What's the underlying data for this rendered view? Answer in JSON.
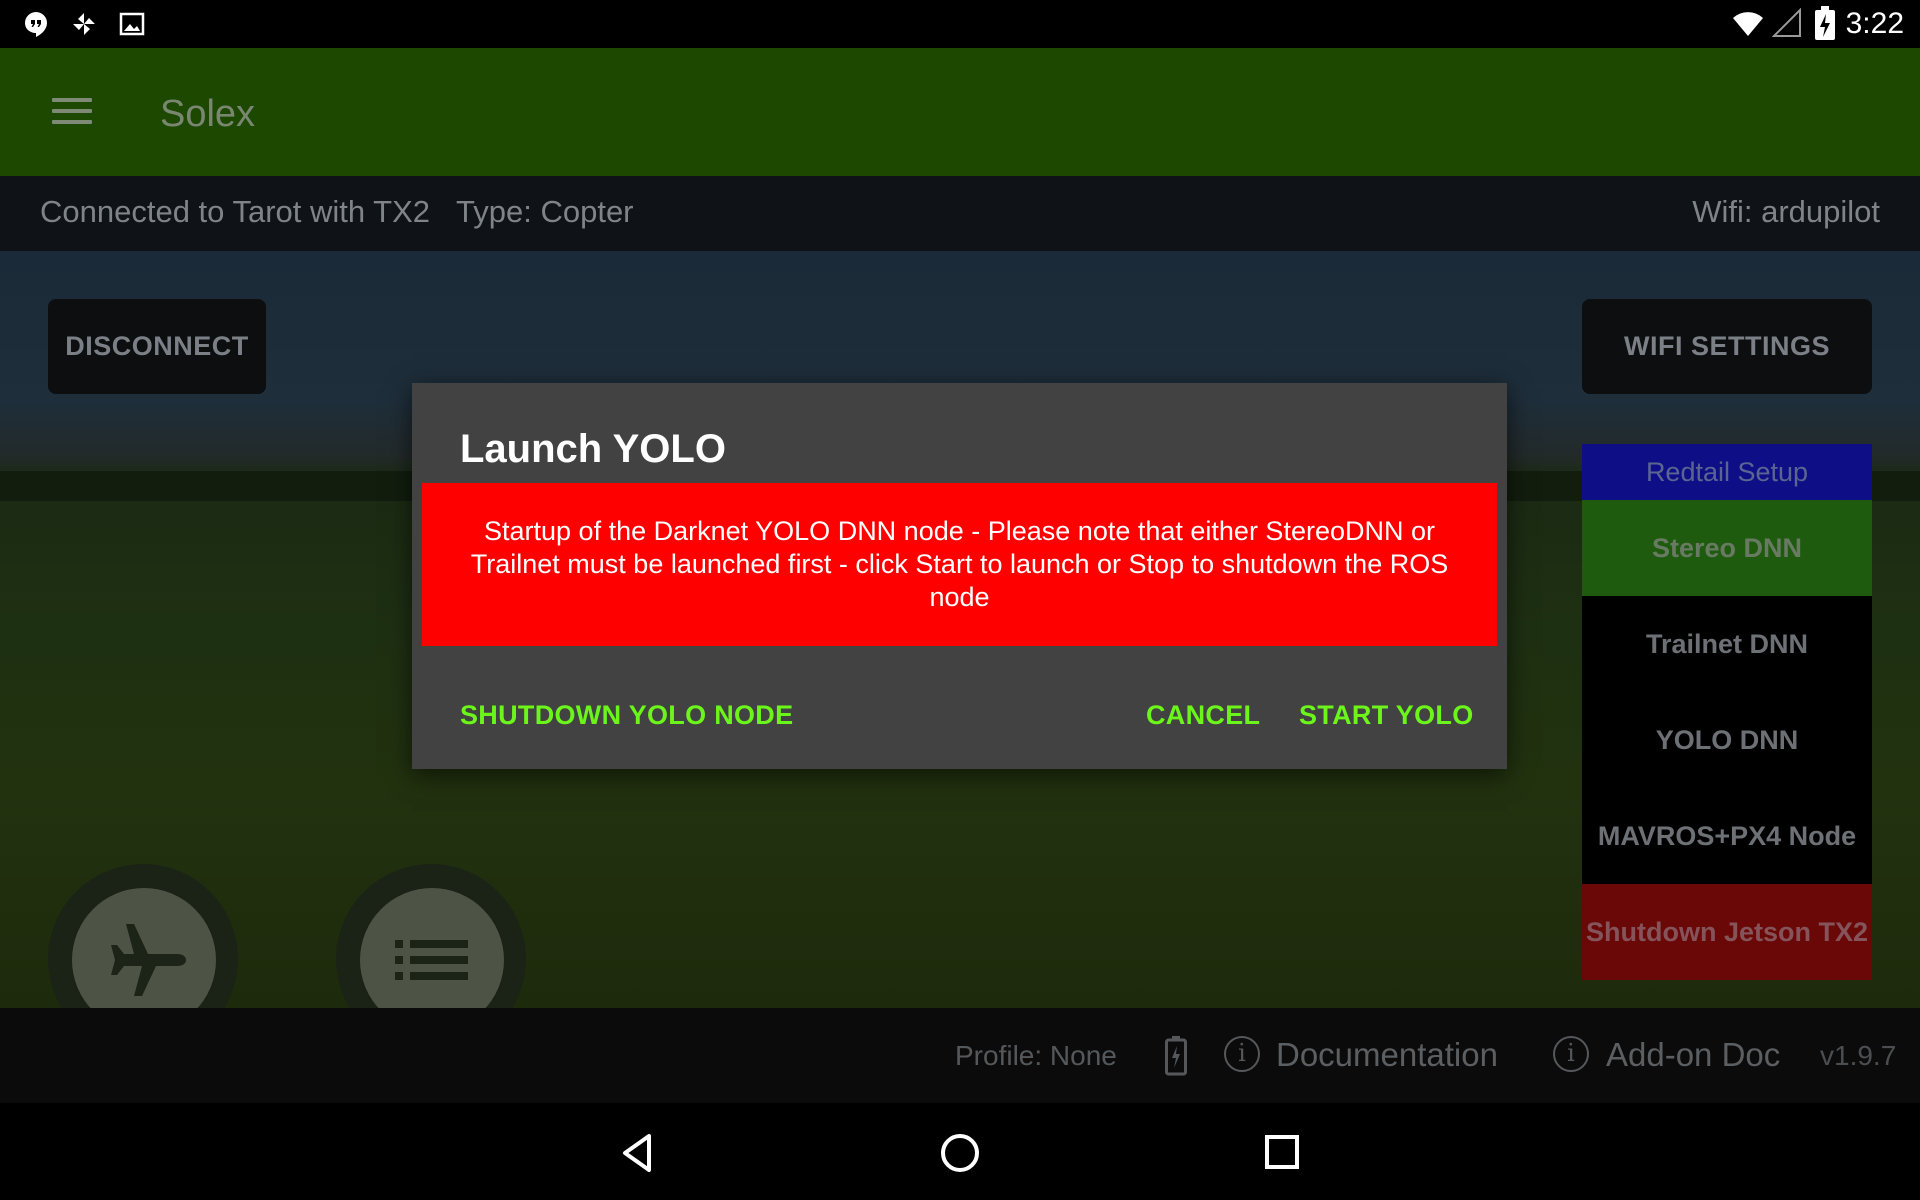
{
  "status_bar": {
    "time": "3:22",
    "left_icons": [
      "hangouts-icon",
      "pinwheel-icon",
      "image-icon"
    ],
    "right_icons": [
      "wifi-icon",
      "signal-icon",
      "battery-charging-icon"
    ]
  },
  "app_bar": {
    "title": "Solex",
    "menu_icon": "hamburger-menu-icon"
  },
  "connection_bar": {
    "status": "Connected to Tarot with TX2",
    "type": "Type: Copter",
    "wifi": "Wifi: ardupilot"
  },
  "buttons": {
    "disconnect": "DISCONNECT",
    "wifi_settings": "WIFI SETTINGS"
  },
  "side_panel": {
    "items": [
      {
        "label": "Redtail Setup",
        "color": "#0e0e86"
      },
      {
        "label": "Stereo DNN",
        "color": "#1f5b0f"
      },
      {
        "label": "Trailnet DNN",
        "color": "#000000"
      },
      {
        "label": "YOLO DNN",
        "color": "#000000"
      },
      {
        "label": "MAVROS+PX4 Node",
        "color": "#000000"
      },
      {
        "label": "Shutdown Jetson TX2",
        "color": "#6a0808"
      }
    ]
  },
  "fabs": [
    "airplane-icon",
    "list-icon"
  ],
  "info_bar": {
    "profile": "Profile: None",
    "documentation": "Documentation",
    "addon_doc": "Add-on Doc",
    "version": "v1.9.7"
  },
  "dialog": {
    "title": "Launch YOLO",
    "message": "Startup of the Darknet YOLO DNN node - Please note that either StereoDNN or Trailnet must be launched first - click Start to launch or Stop to shutdown the ROS node",
    "message_bg": "#ff0000",
    "buttons": {
      "shutdown": "SHUTDOWN YOLO NODE",
      "cancel": "CANCEL",
      "start": "START YOLO"
    },
    "button_color": "#6cf51a"
  },
  "nav_bar": [
    "back-icon",
    "home-icon",
    "recents-icon"
  ]
}
